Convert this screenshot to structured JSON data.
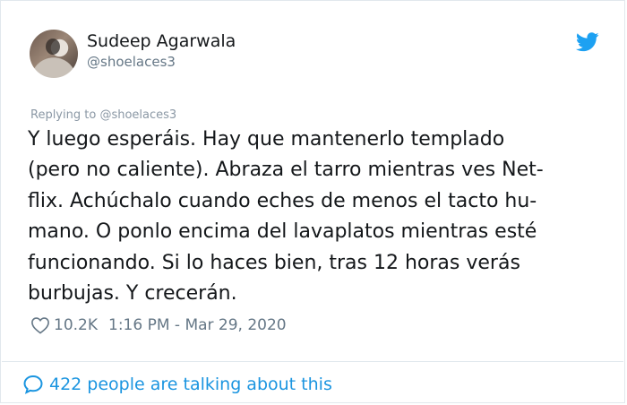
{
  "author": {
    "display_name": "Sudeep Agarwala",
    "handle": "@shoelaces3"
  },
  "icons": {
    "platform": "twitter-bird-icon",
    "like": "heart-icon",
    "replies": "speech-bubble-icon"
  },
  "colors": {
    "brand": "#1da1f2",
    "link": "#1b95e0",
    "muted": "#657786",
    "text": "#14171a"
  },
  "tweet": {
    "replying_prefix": "Replying to",
    "replying_handle": "@shoelaces3",
    "lines": [
      "Y luego esperáis. Hay que mantenerlo templado",
      "(pero no caliente). Abraza el tarro mientras ves Net-",
      "flix. Achúchalo cuando eches de menos el tacto hu-",
      "mano. O ponlo encima del lavaplatos mientras esté",
      "funcionando. Si lo haces bien, tras 12 horas verás",
      "burbujas. Y crecerán."
    ],
    "likes": "10.2K",
    "timestamp": "1:16 PM - Mar 29, 2020"
  },
  "footer": {
    "talking_text": "422 people are talking about this"
  }
}
